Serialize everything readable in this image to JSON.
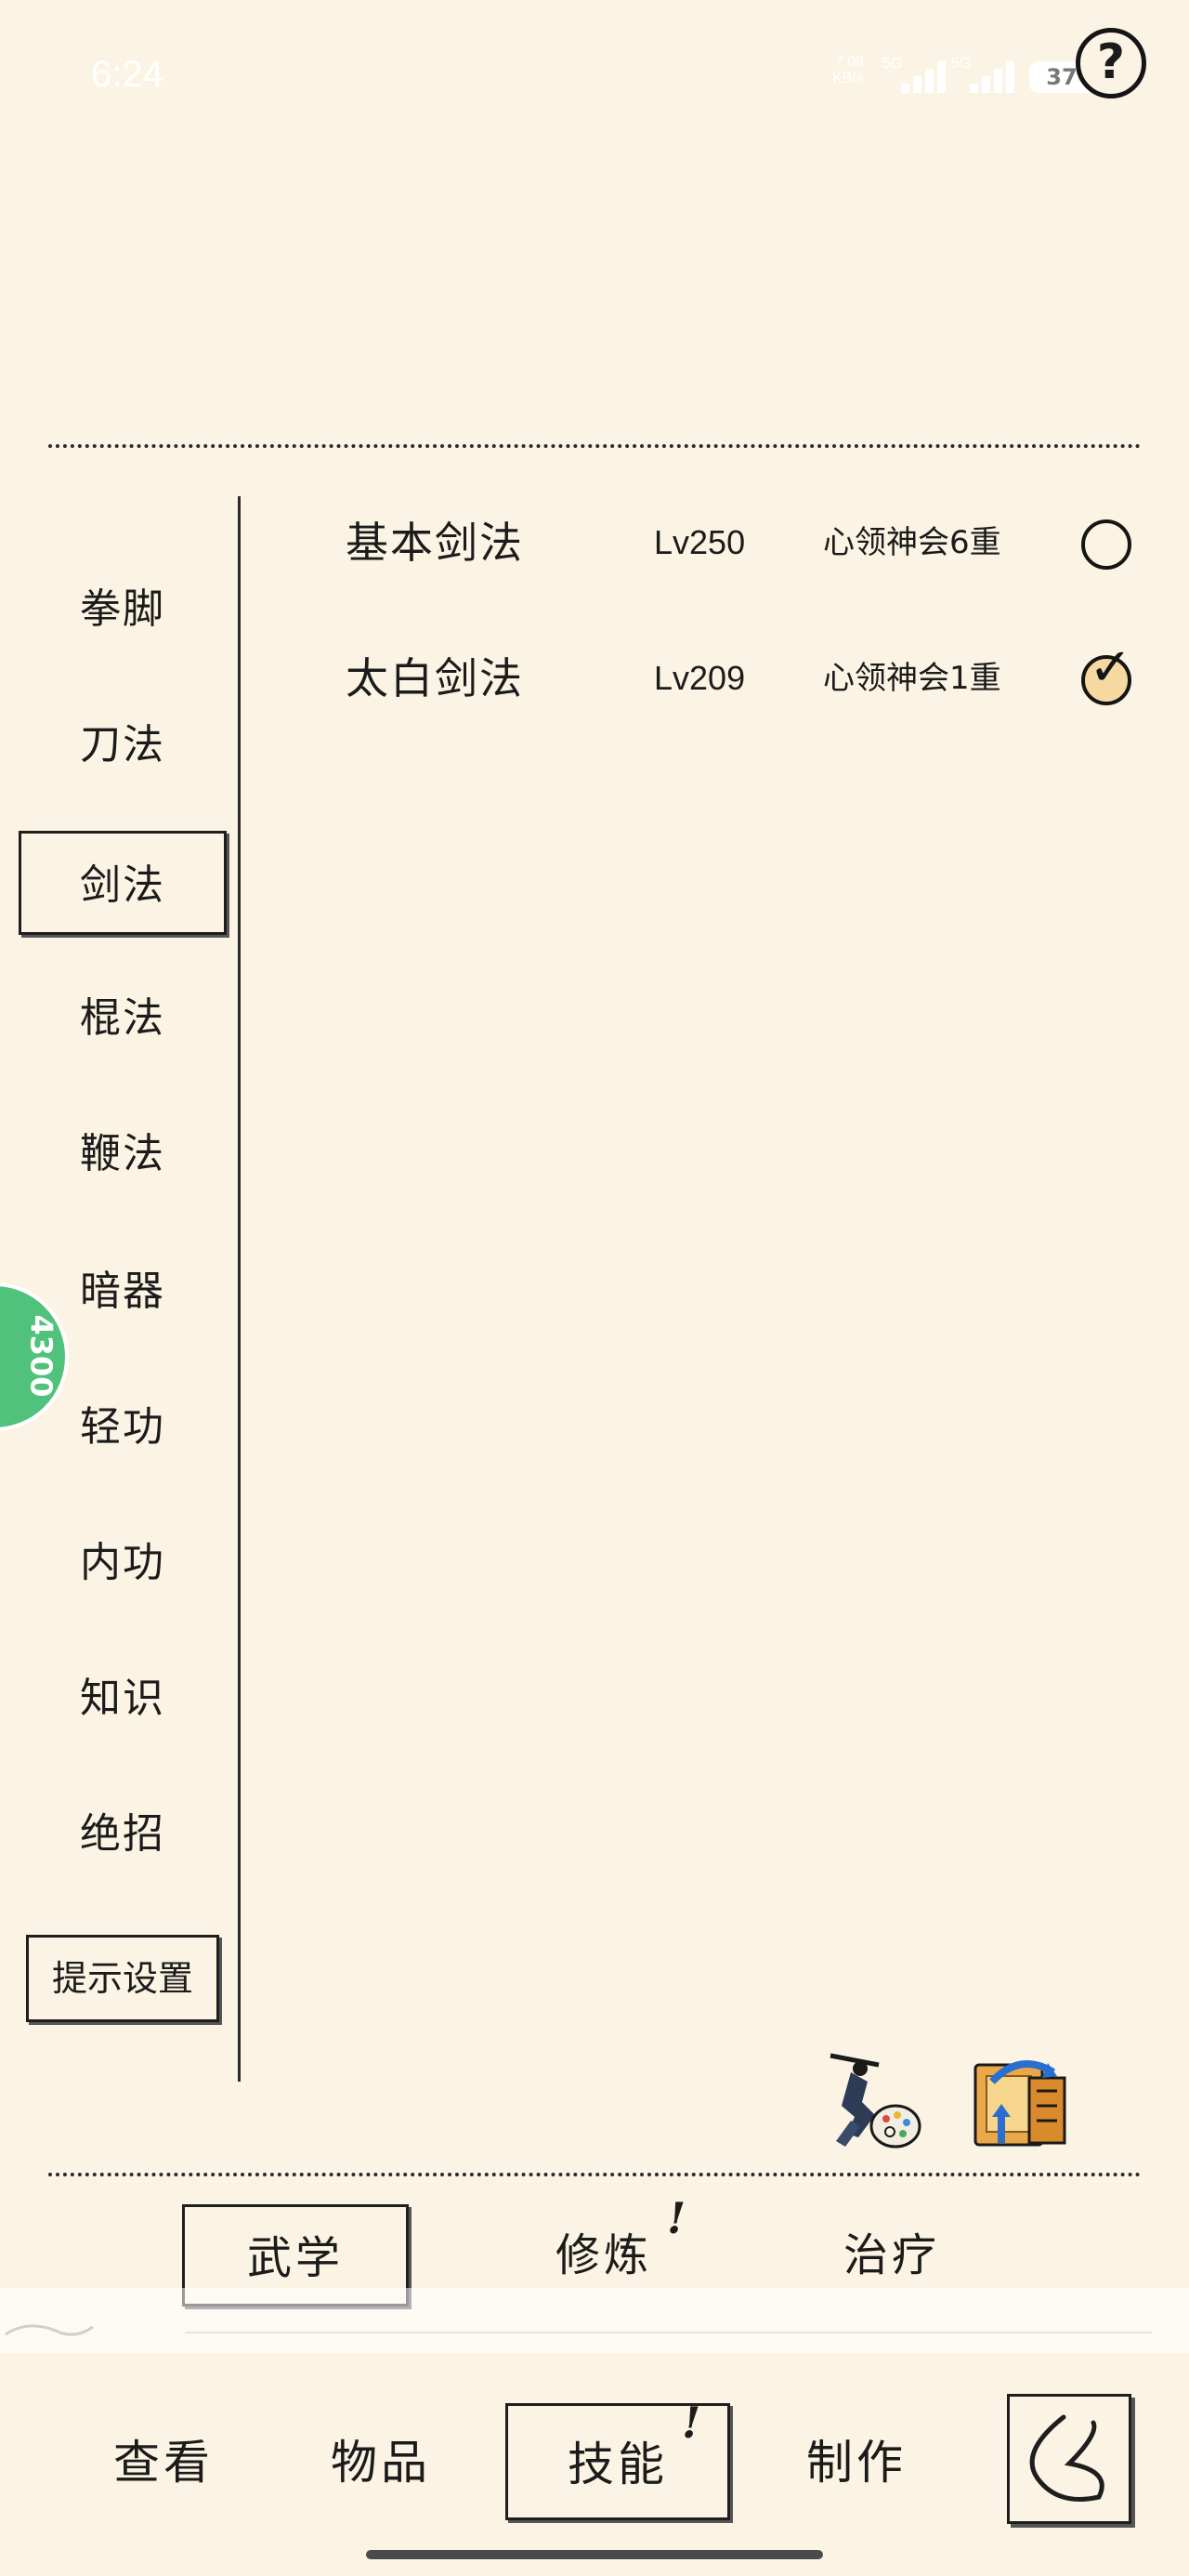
{
  "status_bar": {
    "time": "6:24",
    "net_speed": "7.08",
    "net_unit": "KB/s",
    "signal1": "5G",
    "signal2": "5G",
    "battery": "37"
  },
  "header": {
    "help_label": "?"
  },
  "sidebar": {
    "items": [
      {
        "label": "拳脚"
      },
      {
        "label": "刀法"
      },
      {
        "label": "剑法",
        "selected": true
      },
      {
        "label": "棍法"
      },
      {
        "label": "鞭法"
      },
      {
        "label": "暗器"
      },
      {
        "label": "轻功"
      },
      {
        "label": "内功"
      },
      {
        "label": "知识"
      },
      {
        "label": "绝招"
      }
    ],
    "hint_settings": "提示设置"
  },
  "floating_badge": {
    "text": "4300"
  },
  "skills": [
    {
      "name": "基本剑法",
      "level": "Lv250",
      "state": "心领神会6重",
      "checked": false
    },
    {
      "name": "太白剑法",
      "level": "Lv209",
      "state": "心领神会1重",
      "checked": true
    }
  ],
  "action_icons": [
    {
      "name": "swordsman-palette-icon"
    },
    {
      "name": "scroll-exchange-icon"
    }
  ],
  "sub_tabs": [
    {
      "label": "武学",
      "selected": true
    },
    {
      "label": "修炼",
      "alert": "!"
    },
    {
      "label": "治疗"
    }
  ],
  "bottom_nav": [
    {
      "label": "查看"
    },
    {
      "label": "物品"
    },
    {
      "label": "技能",
      "selected": true,
      "alert": "!"
    },
    {
      "label": "制作"
    }
  ],
  "colors": {
    "background": "#fbf4e4",
    "ink": "#1b1b1b",
    "badge_green": "#50c27c",
    "checked_fill": "#f5d9a0"
  }
}
